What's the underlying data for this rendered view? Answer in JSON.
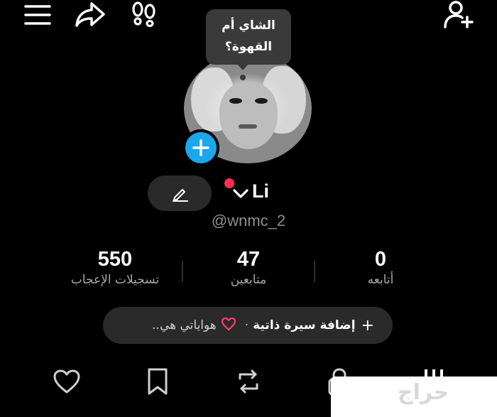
{
  "header": {
    "menu_icon": "hamburger-menu-icon",
    "share_icon": "share-arrow-icon",
    "footprints_icon": "footprints-icon",
    "add_user_icon": "add-user-icon"
  },
  "profile": {
    "bubble_text": "الشاي أم القهوة؟",
    "name": "Li",
    "handle": "@wnmc_2",
    "online_dot_color": "#ff2d55",
    "add_button_color": "#1aa7ec"
  },
  "stats": [
    {
      "value": "550",
      "label": "تسجيلات الإعجاب"
    },
    {
      "value": "47",
      "label": "متابعين"
    },
    {
      "value": "0",
      "label": "أتابعه"
    }
  ],
  "bio": {
    "plus": "+",
    "add_label": "إضافة سيرة ذاتية",
    "separator": "·",
    "hobbies": "هواياتي هي.."
  },
  "tabs": [
    {
      "icon": "tab-menu-icon",
      "name": "videos"
    },
    {
      "icon": "lock-icon",
      "name": "private"
    },
    {
      "icon": "repost-icon",
      "name": "reposts"
    },
    {
      "icon": "bookmark-icon",
      "name": "saved"
    },
    {
      "icon": "heart-icon",
      "name": "liked"
    }
  ],
  "watermark": {
    "text": "حراج"
  }
}
